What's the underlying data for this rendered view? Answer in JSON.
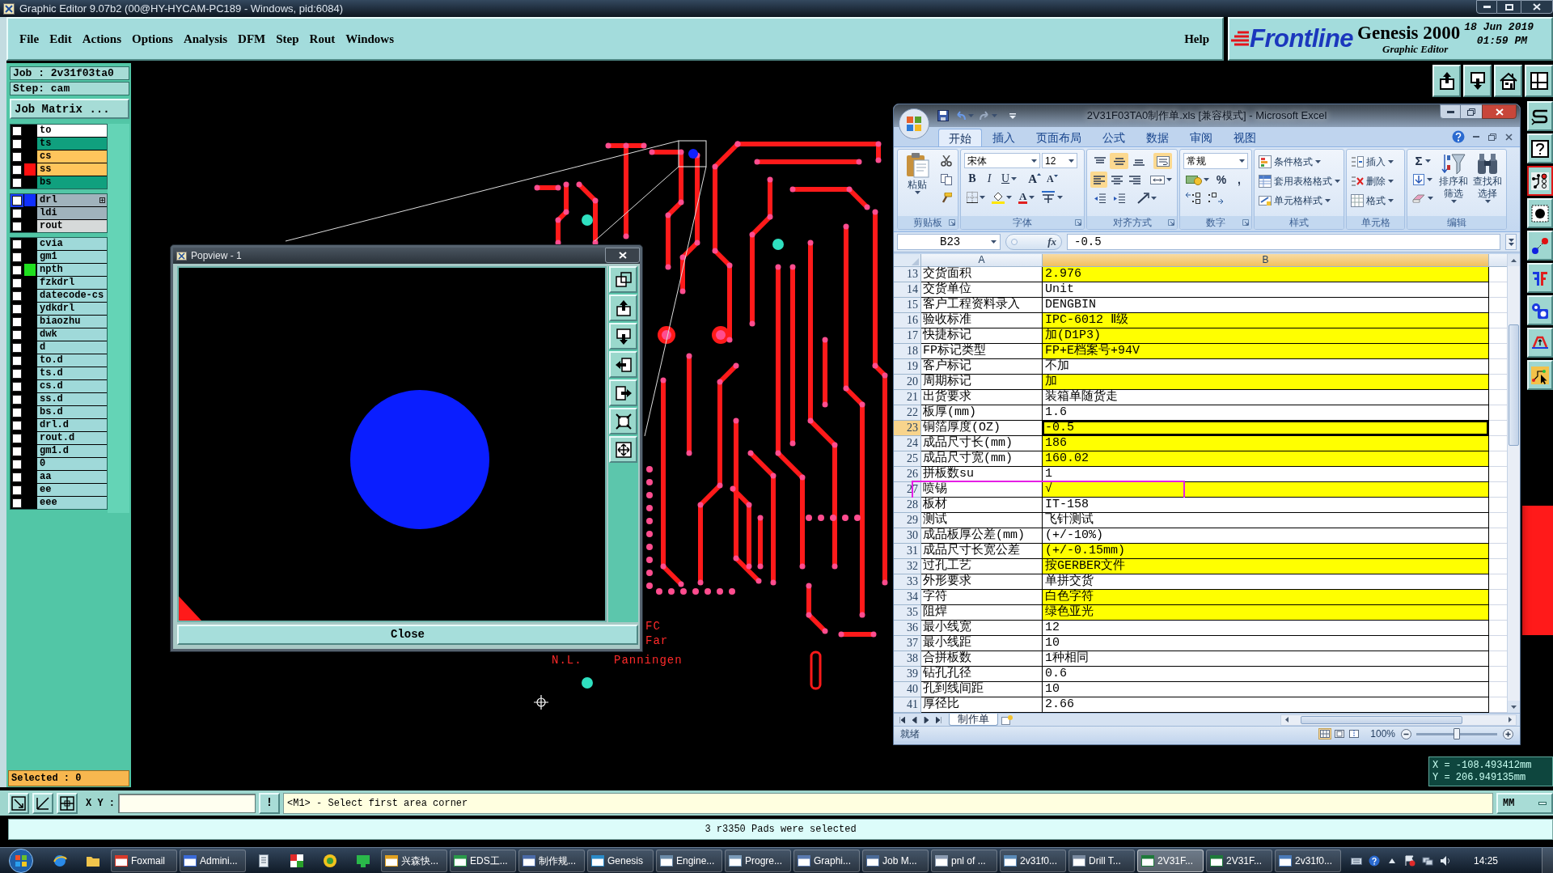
{
  "window": {
    "title": "Graphic Editor 9.07b2 (00@HY-HYCAM-PC189 - Windows, pid:6084)"
  },
  "menu": {
    "items": [
      "File",
      "Edit",
      "Actions",
      "Options",
      "Analysis",
      "DFM",
      "Step",
      "Rout",
      "Windows"
    ],
    "help": "Help"
  },
  "brand": {
    "logo": "Frontline",
    "product": "Genesis 2000",
    "subtitle": "Graphic Editor",
    "date": "18 Jun 2019",
    "time": "01:59 PM"
  },
  "job_panel": {
    "job": "Job : 2v31f03ta0",
    "step": "Step: cam",
    "matrix_button": "Job Matrix ...",
    "selected": "Selected : 0"
  },
  "layer_groups": [
    {
      "layers": [
        {
          "name": "to",
          "color": "#ffffff",
          "checked": false,
          "work": false
        },
        {
          "name": "ts",
          "color": "#10a07e",
          "checked": false,
          "work": false
        },
        {
          "name": "cs",
          "color": "#ffc55c",
          "checked": false,
          "work": false
        },
        {
          "name": "ss",
          "color": "#ffc55c",
          "checked": false,
          "work": false,
          "indicator": {
            "color": "#ff1010"
          }
        },
        {
          "name": "bs",
          "color": "#10a07e",
          "checked": false,
          "work": false
        }
      ]
    },
    {
      "layers": [
        {
          "name": "drl",
          "color": "#a0b3bc",
          "checked": false,
          "work": true,
          "indicator": {
            "color": "#1030ff"
          }
        },
        {
          "name": "ldi",
          "color": "#a0b3bc",
          "checked": false,
          "work": false
        },
        {
          "name": "rout",
          "color": "#d6d9d9",
          "checked": false,
          "work": false
        }
      ]
    },
    {
      "layers": [
        {
          "name": "cvia",
          "color": "#9fd9d9",
          "checked": false,
          "work": false
        },
        {
          "name": "gm1",
          "color": "#9fd9d9",
          "checked": false,
          "work": false
        },
        {
          "name": "npth",
          "color": "#9fd9d9",
          "checked": false,
          "work": false,
          "indicator": {
            "color": "#20e020"
          }
        },
        {
          "name": "fzkdrl",
          "color": "#9fd9d9",
          "checked": false,
          "work": false
        },
        {
          "name": "datecode-cs",
          "color": "#9fd9d9",
          "checked": false,
          "work": false
        },
        {
          "name": "ydkdrl",
          "color": "#9fd9d9",
          "checked": false,
          "work": false
        },
        {
          "name": "biaozhu",
          "color": "#9fd9d9",
          "checked": false,
          "work": false
        },
        {
          "name": "dwk",
          "color": "#9fd9d9",
          "checked": false,
          "work": false
        },
        {
          "name": "d",
          "color": "#9fd9d9",
          "checked": false,
          "work": false
        },
        {
          "name": "to.d",
          "color": "#9fd9d9",
          "checked": false,
          "work": false
        },
        {
          "name": "ts.d",
          "color": "#9fd9d9",
          "checked": false,
          "work": false
        },
        {
          "name": "cs.d",
          "color": "#9fd9d9",
          "checked": false,
          "work": false
        },
        {
          "name": "ss.d",
          "color": "#9fd9d9",
          "checked": false,
          "work": false
        },
        {
          "name": "bs.d",
          "color": "#9fd9d9",
          "checked": false,
          "work": false
        },
        {
          "name": "drl.d",
          "color": "#9fd9d9",
          "checked": false,
          "work": false
        },
        {
          "name": "rout.d",
          "color": "#9fd9d9",
          "checked": false,
          "work": false
        },
        {
          "name": "gm1.d",
          "color": "#9fd9d9",
          "checked": false,
          "work": false
        },
        {
          "name": "0",
          "color": "#9fd9d9",
          "checked": false,
          "work": false
        },
        {
          "name": "aa",
          "color": "#9fd9d9",
          "checked": false,
          "work": false
        },
        {
          "name": "ee",
          "color": "#9fd9d9",
          "checked": false,
          "work": false
        },
        {
          "name": "eee",
          "color": "#9fd9d9",
          "checked": false,
          "work": false
        }
      ]
    }
  ],
  "canvas": {
    "board_labels": [
      "FC",
      "Far",
      "N.L.",
      "Panningen"
    ]
  },
  "side_tools": [
    {
      "active": false
    },
    {
      "active": false
    },
    {
      "active": true
    },
    {
      "active": false
    },
    {
      "active": false
    },
    {
      "active": false
    },
    {
      "active": false
    },
    {
      "active": false
    },
    {
      "active": false
    }
  ],
  "popview": {
    "title": "Popview - 1",
    "close_button": "Close"
  },
  "excel": {
    "title": "2V31F03TA0制作单.xls [兼容模式] - Microsoft Excel",
    "tabs": [
      {
        "label": "开始",
        "selected": true
      },
      {
        "label": "插入",
        "selected": false
      },
      {
        "label": "页面布局",
        "selected": false
      },
      {
        "label": "公式",
        "selected": false
      },
      {
        "label": "数据",
        "selected": false
      },
      {
        "label": "审阅",
        "selected": false
      },
      {
        "label": "视图",
        "selected": false
      }
    ],
    "ribbon": [
      {
        "kind": "clipboard",
        "label": "剪贴板",
        "paste": "粘贴"
      },
      {
        "kind": "font",
        "label": "字体",
        "font": "宋体",
        "size": "12",
        "styles": [
          {
            "label": "B",
            "on": false
          },
          {
            "label": "I",
            "on": false
          },
          {
            "label": "U",
            "on": false
          }
        ],
        "size_buttons": [
          "A",
          "A"
        ],
        "color_button": "A"
      },
      {
        "kind": "alignment",
        "label": "对齐方式",
        "toggles": [
          {
            "on": false
          },
          {
            "on": true
          },
          {
            "on": false
          },
          {
            "on": true
          },
          {
            "on": true
          },
          {
            "on": false
          },
          {
            "on": false
          }
        ]
      },
      {
        "kind": "number",
        "label": "数字",
        "format": "常规",
        "symbols": [
          "%",
          ","
        ]
      },
      {
        "kind": "styles",
        "label": "样式",
        "items": [
          "条件格式",
          "套用表格格式",
          "单元格样式"
        ]
      },
      {
        "kind": "cells",
        "label": "单元格",
        "items": [
          "插入",
          "删除",
          "格式"
        ]
      },
      {
        "kind": "editing",
        "label": "编辑",
        "sum": "Σ",
        "items": [
          "排序和筛选",
          "查找和选择"
        ]
      }
    ],
    "name_box": "B23",
    "function_button": "fx",
    "formula": "-0.5",
    "columns": [
      {
        "label": "A",
        "selected": false
      },
      {
        "label": "B",
        "selected": true
      }
    ],
    "rows": [
      {
        "number": "13",
        "label": "交货面积",
        "value": "2.976",
        "color": "#ffff00",
        "selected": false,
        "highlighted": false
      },
      {
        "number": "14",
        "label": "交货单位",
        "value": "Unit",
        "color": "#ffffff",
        "selected": false,
        "highlighted": false
      },
      {
        "number": "15",
        "label": "客户工程资料录入",
        "value": "DENGBIN",
        "color": "#ffffff",
        "selected": false,
        "highlighted": false
      },
      {
        "number": "16",
        "label": "验收标准",
        "value": "IPC-6012 Ⅱ级",
        "color": "#ffff00",
        "selected": false,
        "highlighted": false
      },
      {
        "number": "17",
        "label": "快捷标记",
        "value": "加(D1P3)",
        "color": "#ffff00",
        "selected": false,
        "highlighted": false
      },
      {
        "number": "18",
        "label": "FP标记类型",
        "value": "FP+E档案号+94V",
        "color": "#ffff00",
        "selected": false,
        "highlighted": false
      },
      {
        "number": "19",
        "label": "客户标记",
        "value": "不加",
        "color": "#ffffff",
        "selected": false,
        "highlighted": false
      },
      {
        "number": "20",
        "label": "周期标记",
        "value": "加",
        "color": "#ffff00",
        "selected": false,
        "highlighted": false
      },
      {
        "number": "21",
        "label": "出货要求",
        "value": "装箱单随货走",
        "color": "#ffffff",
        "selected": false,
        "highlighted": false
      },
      {
        "number": "22",
        "label": "板厚(mm)",
        "value": "1.6",
        "color": "#ffffff",
        "selected": false,
        "highlighted": false
      },
      {
        "number": "23",
        "label": "铜箔厚度(OZ)",
        "value": "-0.5",
        "color": "#ffff00",
        "selected": true,
        "highlighted": false
      },
      {
        "number": "24",
        "label": "成品尺寸长(mm)",
        "value": "186",
        "color": "#ffff00",
        "selected": false,
        "highlighted": false
      },
      {
        "number": "25",
        "label": "成品尺寸宽(mm)",
        "value": "160.02",
        "color": "#ffff00",
        "selected": false,
        "highlighted": false
      },
      {
        "number": "26",
        "label": "拼板数su",
        "value": "1",
        "color": "#ffffff",
        "selected": false,
        "highlighted": false
      },
      {
        "number": "27",
        "label": "喷锡",
        "value": "√",
        "color": "#ffff00",
        "selected": false,
        "highlighted": true
      },
      {
        "number": "28",
        "label": "板材",
        "value": "IT-158",
        "color": "#ffffff",
        "selected": false,
        "highlighted": false
      },
      {
        "number": "29",
        "label": "测试",
        "value": "飞针测试",
        "color": "#ffffff",
        "selected": false,
        "highlighted": false
      },
      {
        "number": "30",
        "label": "成品板厚公差(mm)",
        "value": "(+/-10%)",
        "color": "#ffffff",
        "selected": false,
        "highlighted": false
      },
      {
        "number": "31",
        "label": "成品尺寸长宽公差",
        "value": "(+/-0.15mm)",
        "color": "#ffff00",
        "selected": false,
        "highlighted": false
      },
      {
        "number": "32",
        "label": "过孔工艺",
        "value": "按GERBER文件",
        "color": "#ffff00",
        "selected": false,
        "highlighted": false
      },
      {
        "number": "33",
        "label": "外形要求",
        "value": "单拼交货",
        "color": "#ffffff",
        "selected": false,
        "highlighted": false
      },
      {
        "number": "34",
        "label": "字符",
        "value": "白色字符",
        "color": "#ffff00",
        "selected": false,
        "highlighted": false
      },
      {
        "number": "35",
        "label": "阻焊",
        "value": "绿色亚光",
        "color": "#ffff00",
        "selected": false,
        "highlighted": false
      },
      {
        "number": "36",
        "label": "最小线宽",
        "value": "12",
        "color": "#ffffff",
        "selected": false,
        "highlighted": false
      },
      {
        "number": "37",
        "label": "最小线距",
        "value": "10",
        "color": "#ffffff",
        "selected": false,
        "highlighted": false
      },
      {
        "number": "38",
        "label": "合拼板数",
        "value": "1种相同",
        "color": "#ffffff",
        "selected": false,
        "highlighted": false
      },
      {
        "number": "39",
        "label": "钻孔孔径",
        "value": "0.6",
        "color": "#ffffff",
        "selected": false,
        "highlighted": false
      },
      {
        "number": "40",
        "label": "孔到线间距",
        "value": "10",
        "color": "#ffffff",
        "selected": false,
        "highlighted": false
      },
      {
        "number": "41",
        "label": "厚径比",
        "value": "2.66",
        "color": "#ffffff",
        "selected": false,
        "highlighted": false
      }
    ],
    "sheet_tab": "制作单",
    "status": "就绪",
    "zoom": "100%",
    "zoom_slider": {
      "level": 0.5
    }
  },
  "coordinates": {
    "x": "X = -108.493412mm",
    "y": "Y = 206.949135mm"
  },
  "command_bar": {
    "label": "X Y :",
    "exec_button": "!",
    "message": "<M1> - Select first area corner",
    "units": "MM"
  },
  "status_bar": {
    "text": "3 r3350 Pads were selected"
  },
  "taskbar": {
    "items": [
      {
        "kind": "pin",
        "selected": false
      },
      {
        "kind": "pin",
        "selected": false
      },
      {
        "kind": "app",
        "label": "Foxmail",
        "selected": false
      },
      {
        "kind": "app",
        "label": "Admini...",
        "selected": false
      },
      {
        "kind": "pin",
        "selected": false
      },
      {
        "kind": "pin",
        "selected": false
      },
      {
        "kind": "pin",
        "selected": false
      },
      {
        "kind": "pin",
        "selected": false
      },
      {
        "kind": "app",
        "label": "兴森快...",
        "selected": false
      },
      {
        "kind": "app",
        "label": "EDS工...",
        "selected": false
      },
      {
        "kind": "app",
        "label": "制作规...",
        "selected": false
      },
      {
        "kind": "app",
        "label": "Genesis",
        "selected": false
      },
      {
        "kind": "app",
        "label": "Engine...",
        "selected": false
      },
      {
        "kind": "app",
        "label": "Progre...",
        "selected": false
      },
      {
        "kind": "app",
        "label": "Graphi...",
        "selected": false
      },
      {
        "kind": "app",
        "label": "Job M...",
        "selected": false
      },
      {
        "kind": "app",
        "label": "pnl of ...",
        "selected": false
      },
      {
        "kind": "app",
        "label": "2v31f0...",
        "selected": false
      },
      {
        "kind": "app",
        "label": "Drill T...",
        "selected": false
      },
      {
        "kind": "app",
        "label": "2V31F...",
        "selected": true
      },
      {
        "kind": "app",
        "label": "2V31F...",
        "selected": false
      },
      {
        "kind": "app",
        "label": "2v31f0...",
        "selected": false
      }
    ],
    "clock": "14:25"
  }
}
